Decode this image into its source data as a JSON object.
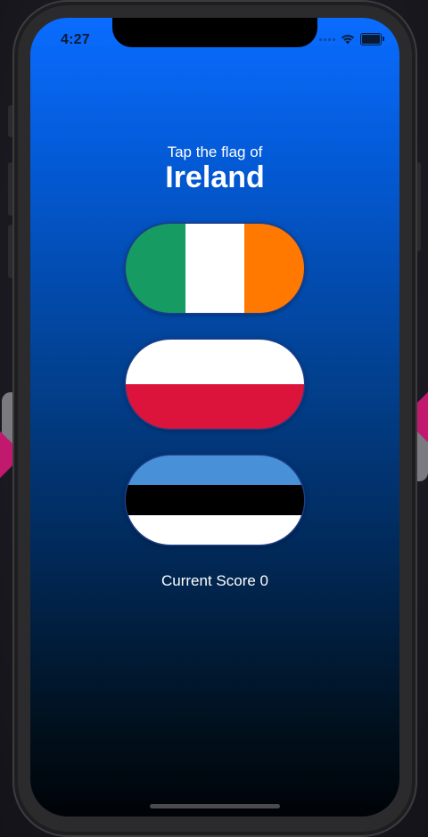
{
  "status_bar": {
    "time": "4:27",
    "icons": [
      "cellular-dots-icon",
      "wifi-icon",
      "battery-icon"
    ],
    "battery_level": 1.0
  },
  "game": {
    "prompt": "Tap the flag of",
    "country": "Ireland",
    "score_text": "Current Score 0"
  },
  "flags": [
    {
      "name": "Ireland",
      "orientation": "vertical",
      "stripes": [
        "#169b62",
        "#ffffff",
        "#ff7900"
      ]
    },
    {
      "name": "Poland",
      "orientation": "horizontal",
      "stripes": [
        "#ffffff",
        "#dc143c"
      ]
    },
    {
      "name": "Estonia",
      "orientation": "horizontal",
      "stripes": [
        "#4891d9",
        "#000000",
        "#ffffff"
      ]
    }
  ],
  "colors": {
    "background_top": "#0a6cff",
    "background_bottom": "#000307",
    "text": "#ffffff"
  }
}
